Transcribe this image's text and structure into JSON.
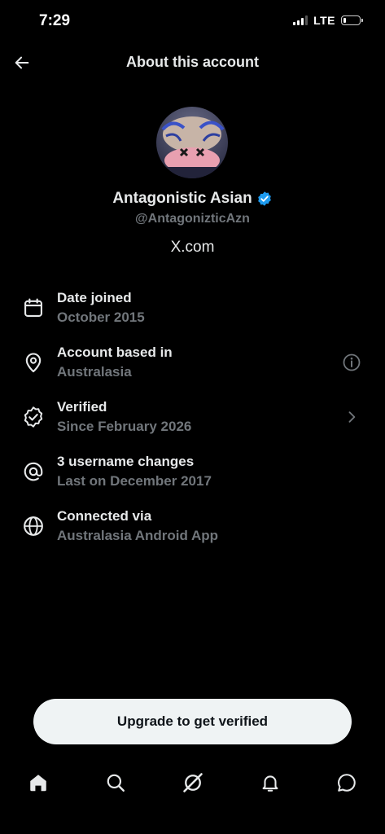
{
  "status_bar": {
    "time": "7:29",
    "network": "LTE",
    "signal_bars_active": 3,
    "battery_level": 0.2
  },
  "header": {
    "title": "About this account",
    "back_icon": "arrow-left-icon"
  },
  "profile": {
    "display_name": "Antagonistic Asian",
    "handle": "@AntagonizticAzn",
    "site": "X.com",
    "verified_badge_color": "#1d9bf0"
  },
  "info_rows": [
    {
      "icon": "calendar-icon",
      "title": "Date joined",
      "subtitle": "October 2015"
    },
    {
      "icon": "location-pin-icon",
      "title": "Account based in",
      "subtitle": "Australasia",
      "action_icon": "info-circle-icon"
    },
    {
      "icon": "verified-badge-icon",
      "title": "Verified",
      "subtitle": "Since February 2026",
      "action_icon": "chevron-right-icon"
    },
    {
      "icon": "at-sign-icon",
      "title": "3 username changes",
      "subtitle": "Last on December 2017"
    },
    {
      "icon": "globe-icon",
      "title": "Connected via",
      "subtitle": "Australasia Android App"
    }
  ],
  "cta": {
    "label": "Upgrade to get verified"
  },
  "tab_bar": {
    "tabs": [
      {
        "icon": "home-icon",
        "active": true
      },
      {
        "icon": "search-icon",
        "active": false
      },
      {
        "icon": "grok-icon",
        "active": false
      },
      {
        "icon": "bell-icon",
        "active": false
      },
      {
        "icon": "messages-icon",
        "active": false
      }
    ]
  },
  "colors": {
    "background": "#000000",
    "primary_text": "#e7e9ea",
    "secondary_text": "#71767b",
    "accent": "#1d9bf0",
    "button_bg": "#eff3f4"
  }
}
